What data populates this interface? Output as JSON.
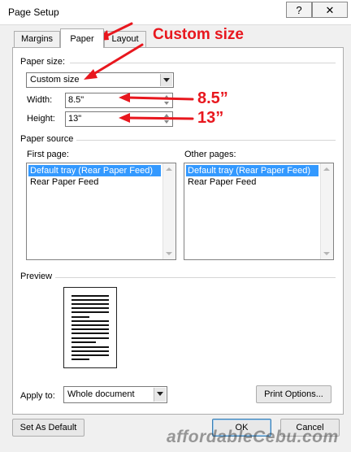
{
  "window": {
    "title": "Page Setup",
    "help_label": "?",
    "close_label": "✕"
  },
  "tabs": [
    {
      "label": "Margins",
      "active": false
    },
    {
      "label": "Paper",
      "active": true
    },
    {
      "label": "Layout",
      "active": false
    }
  ],
  "paper_size": {
    "group_label": "Paper size:",
    "selected": "Custom size",
    "width_label": "Width:",
    "width_value": "8.5\"",
    "height_label": "Height:",
    "height_value": "13\""
  },
  "paper_source": {
    "group_label": "Paper source",
    "first_page_label": "First page:",
    "other_pages_label": "Other pages:",
    "first_page_items": [
      "Default tray (Rear Paper Feed)",
      "Rear Paper Feed"
    ],
    "other_pages_items": [
      "Default tray (Rear Paper Feed)",
      "Rear Paper Feed"
    ]
  },
  "preview": {
    "group_label": "Preview"
  },
  "apply": {
    "label": "Apply to:",
    "selected": "Whole document"
  },
  "buttons": {
    "print_options": "Print Options...",
    "set_as_default": "Set As Default",
    "ok": "OK",
    "cancel": "Cancel"
  },
  "annotations": {
    "custom_size": "Custom size",
    "width": "8.5”",
    "height": "13”",
    "color": "#e8171e"
  },
  "watermark": "affordableCebu.com",
  "colors": {
    "selection": "#3399ff",
    "dialog_bg": "#f0f0f0"
  }
}
